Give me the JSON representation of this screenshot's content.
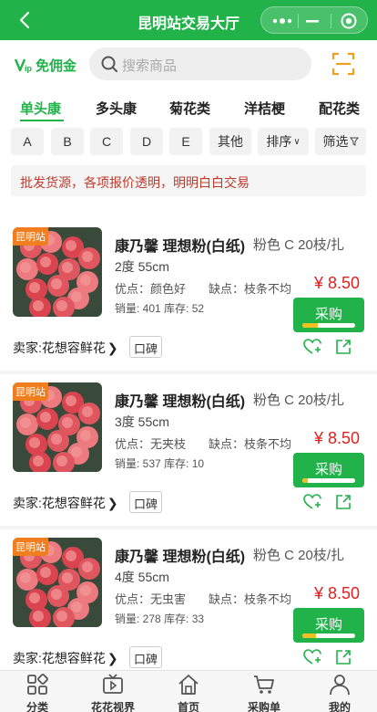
{
  "titlebar": {
    "title": "昆明站交易大厅"
  },
  "header": {
    "vip_label": "免佣金",
    "search_placeholder": "搜索商品"
  },
  "tabs": [
    "单头康",
    "多头康",
    "菊花类",
    "洋桔梗",
    "配花类"
  ],
  "active_tab": 0,
  "filters": {
    "grades": [
      "A",
      "B",
      "C",
      "D",
      "E",
      "其他"
    ],
    "sort": "排序",
    "filter": "筛选"
  },
  "notice": "批发货源，各项报价透明，明明白白交易",
  "products": [
    {
      "station": "昆明站",
      "name": "康乃馨 理想粉(白纸)",
      "spec": "粉色  C  20枝/扎",
      "length": "2度  55cm",
      "pros": "优点：颜色好",
      "cons": "缺点：枝条不均",
      "sales": "销量: 401 库存: 52",
      "price": "¥ 8.50",
      "buy": "采购",
      "progress": 0.3,
      "seller": "卖家:花想容鲜花",
      "rate": "口碑"
    },
    {
      "station": "昆明站",
      "name": "康乃馨 理想粉(白纸)",
      "spec": "粉色  C  20枝/扎",
      "length": "3度  55cm",
      "pros": "优点：无夹枝",
      "cons": "缺点：枝条不均",
      "sales": "销量: 537 库存: 10",
      "price": "¥ 8.50",
      "buy": "采购",
      "progress": 0.1,
      "seller": "卖家:花想容鲜花",
      "rate": "口碑"
    },
    {
      "station": "昆明站",
      "name": "康乃馨 理想粉(白纸)",
      "spec": "粉色  C  20枝/扎",
      "length": "4度  55cm",
      "pros": "优点：无虫害",
      "cons": "缺点：枝条不均",
      "sales": "销量: 278 库存: 33",
      "price": "¥ 8.50",
      "buy": "采购",
      "progress": 0.25,
      "seller": "卖家:花想容鲜花",
      "rate": "口碑"
    }
  ],
  "bottomnav": [
    "分类",
    "花花视界",
    "首页",
    "采购单",
    "我的"
  ],
  "colors": {
    "brand": "#21b24a",
    "price": "#e02020",
    "station_badge": "#f07d1e"
  }
}
